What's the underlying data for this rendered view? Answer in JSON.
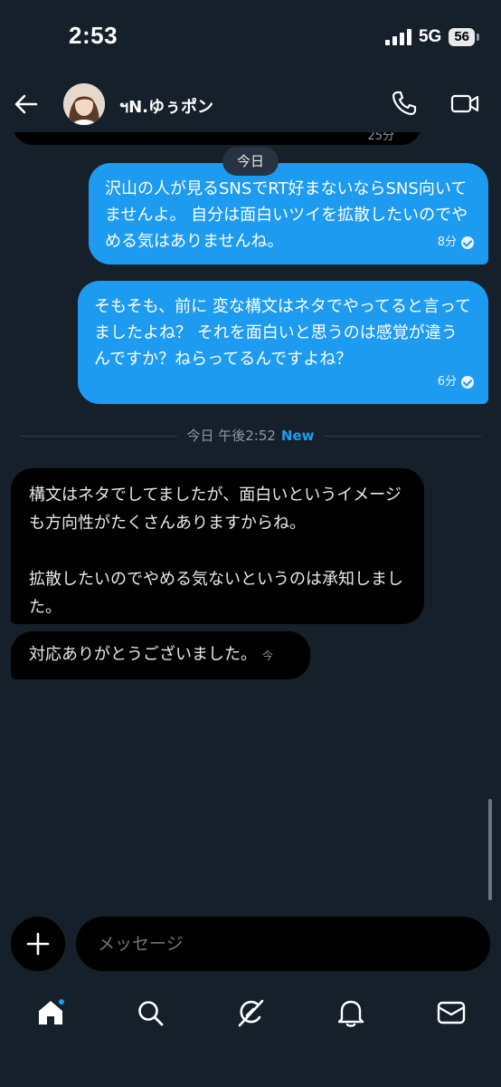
{
  "status_bar": {
    "time": "2:53",
    "network": "5G",
    "battery": "56"
  },
  "header": {
    "contact_name": "ฯN.ゆぅポン",
    "back_icon": "arrow-left-icon",
    "call_icon": "phone-icon",
    "video_icon": "video-camera-icon"
  },
  "conversation": {
    "previous_time_fragment": "25分",
    "date_pill": "今日",
    "outgoing": [
      {
        "text": "沢山の人が見るSNSでRT好まないならSNS向いてませんよ。 自分は面白いツイを拡散したいのでやめる気はありませんね。",
        "time": "8分"
      },
      {
        "text": "そもそも、前に 変な構文はネタでやってると言ってましたよね？ それを面白いと思うのは感覚が違うんですか？ねらってるんですよね？",
        "time": "6分"
      }
    ],
    "divider": {
      "label": "今日 午後2:52",
      "new": "New"
    },
    "incoming": [
      {
        "line1": "構文はネタでしてましたが、面白いというイメージも方向性がたくさんありますからね。",
        "line2": "拡散したいのでやめる気ないというのは承知しました。"
      },
      {
        "text": "対応ありがとうございました。",
        "time": "今"
      }
    ]
  },
  "composer": {
    "placeholder": "メッセージ",
    "plus_icon": "plus-icon"
  },
  "nav": [
    {
      "name": "home-icon",
      "active": true
    },
    {
      "name": "search-icon"
    },
    {
      "name": "grok-icon"
    },
    {
      "name": "bell-icon"
    },
    {
      "name": "mail-icon"
    }
  ],
  "colors": {
    "background": "#15202b",
    "accent": "#1d9bf0",
    "incoming_bubble": "#000000"
  }
}
